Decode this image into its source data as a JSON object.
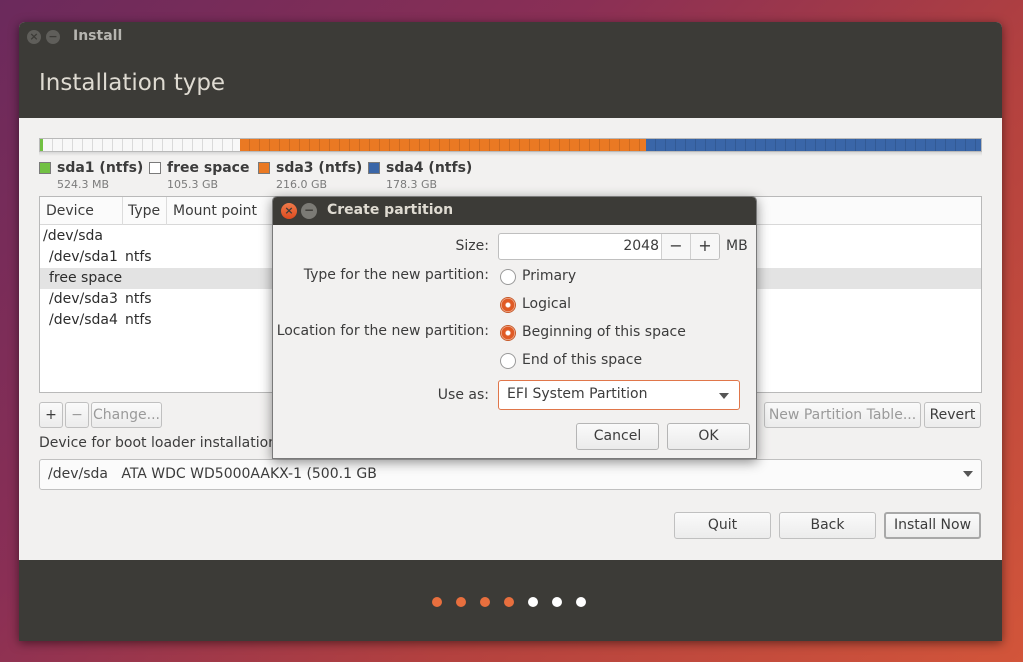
{
  "window": {
    "title": "Install",
    "page_title": "Installation type"
  },
  "partitions_legend": [
    {
      "name": "sda1 (ntfs)",
      "size": "524.3 MB",
      "color": "#72c143"
    },
    {
      "name": "free space",
      "size": "105.3 GB",
      "color": "#ffffff"
    },
    {
      "name": "sda3 (ntfs)",
      "size": "216.0 GB",
      "color": "#ea7923"
    },
    {
      "name": "sda4 (ntfs)",
      "size": "178.3 GB",
      "color": "#3a66a8"
    }
  ],
  "table": {
    "columns": [
      "Device",
      "Type",
      "Mount point"
    ],
    "rows": [
      {
        "device": "/dev/sda",
        "type": ""
      },
      {
        "device": "/dev/sda1",
        "type": "ntfs"
      },
      {
        "device": "free space",
        "type": ""
      },
      {
        "device": "/dev/sda3",
        "type": "ntfs"
      },
      {
        "device": "/dev/sda4",
        "type": "ntfs"
      }
    ]
  },
  "toolbar": {
    "add": "+",
    "remove": "−",
    "change": "Change...",
    "new_table": "New Partition Table...",
    "revert": "Revert"
  },
  "boot": {
    "label": "Device for boot loader installation:",
    "value": "/dev/sda   ATA WDC WD5000AAKX-1 (500.1 GB"
  },
  "nav": {
    "quit": "Quit",
    "back": "Back",
    "install": "Install Now"
  },
  "progress_dots": {
    "completed": 4,
    "total": 7,
    "active_color": "#e86f3e",
    "inactive_color": "#ffffff"
  },
  "dialog": {
    "title": "Create partition",
    "size_label": "Size:",
    "size_value": "2048",
    "size_minus": "−",
    "size_plus": "+",
    "size_unit": "MB",
    "type_label": "Type for the new partition:",
    "type_primary": "Primary",
    "type_logical": "Logical",
    "location_label": "Location for the new partition:",
    "location_begin": "Beginning of this space",
    "location_end": "End of this space",
    "use_label": "Use as:",
    "use_value": "EFI System Partition",
    "cancel": "Cancel",
    "ok": "OK"
  }
}
